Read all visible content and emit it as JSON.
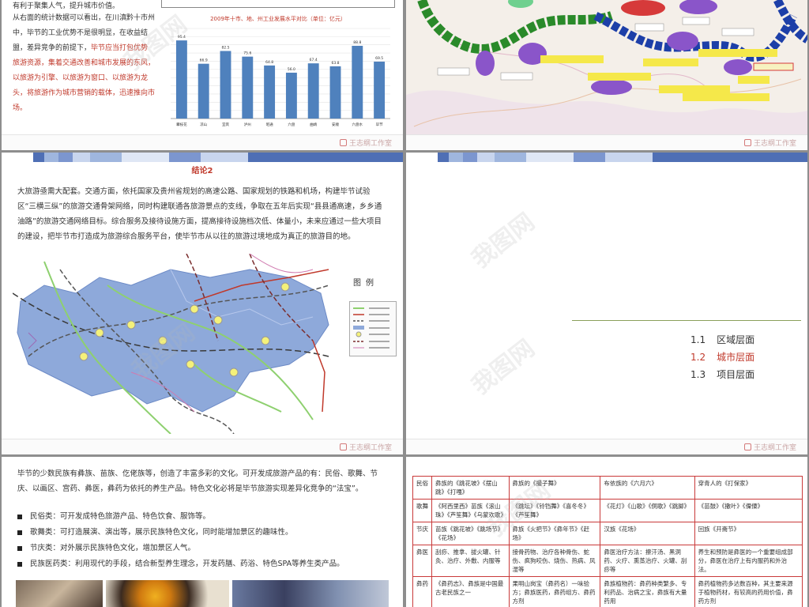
{
  "brand": "王志纲工作室",
  "watermark": "我图网",
  "slide1": {
    "top_fragment": "有利于聚集人气，提升城市价值。",
    "para_normal": "从右面的统计数据可以看出，在川滇黔十市州中，毕节的工业优势不是很明显，在收益结盟，差异竞争的前提下，",
    "para_red": "毕节应当打包优势旅游资源，集着交通改善和城市发展的东风，以旅游为引擎、以旅游为窗口、以旅游为龙头，将旅游作为城市营销的载体，迅速推向市场。"
  },
  "chart_data": {
    "type": "bar",
    "title": "2009年十市、地、州工业发展水平对比（单位：亿元）",
    "categories": [
      "攀枝花",
      "凉山",
      "宜宾",
      "泸州",
      "昭通",
      "六盘",
      "曲靖",
      "安顺",
      "六盘水",
      "毕节"
    ],
    "values": [
      95.4,
      66.9,
      82.5,
      75.6,
      64.8,
      56.0,
      67.4,
      63.8,
      88.8,
      69.5
    ],
    "data_labels": [
      "95.4",
      "66.9",
      "82.5",
      "75.6",
      "64.8",
      "56.0",
      "67.4",
      "63.8",
      "88.8",
      "69.5"
    ],
    "ylim": [
      0,
      110
    ],
    "grid": true,
    "bar_color": "#4f81bd"
  },
  "slide3": {
    "title": "结论2",
    "body": "大旅游亟需大配套。交通方面，依托国家及贵州省规划的高速公路、国家规划的铁路和机场，构建毕节试验区“三横三纵”的旅游交通骨架网络，同时构建联通各旅游景点的支线，争取在五年后实现“县县通高速，乡乡通油路”的旅游交通网络目标。综合服务及接待设施方面，提高接待设施档次低、体量小，未来应通过一些大项目的建设，把毕节市打造成为旅游综合服务平台，使毕节市从以往的旅游过境地成为真正的旅游目的地。",
    "legend_title": "图例"
  },
  "slide4": {
    "toc": [
      {
        "num": "1.1",
        "label": "区域层面",
        "active": false
      },
      {
        "num": "1.2",
        "label": "城市层面",
        "active": true
      },
      {
        "num": "1.3",
        "label": "项目层面",
        "active": false
      }
    ]
  },
  "slide5": {
    "intro": "毕节的少数民族有彝族、苗族、仡佬族等，创造了丰富多彩的文化。可开发成旅游产品的有：民俗、歌舞、节庆、以画区、宫药、彝医，彝药为依托的养生产品。特色文化必将是毕节旅游实现差异化竞争的“法宝”。",
    "bullets": [
      "民俗类：可开发成特色旅游产品、特色饮食、服饰等。",
      "歌舞类：可打造展演、演出等，展示民族特色文化，同时能增加景区的趣味性。",
      "节庆类：对外展示民族特色文化，增加景区人气。",
      "民族医药类：利用现代的手段，结合新型养生理念，开发药膳、药浴、特色SPA等养生类产品。"
    ]
  },
  "slide6": {
    "rows": [
      {
        "head": "民俗",
        "cells": [
          "彝族的《跳花坡》《摆山跳》《打嘎》",
          "彝族的《撮子舞》",
          "布依族的《六月六》",
          "穿青人的《打保家》"
        ]
      },
      {
        "head": "歌舞",
        "cells": [
          "《阿西里西》苗族《滚山珠》《芦笙舞》《乌蒙欢歌》",
          "《跳坛》《铃铛舞》《喜冬冬》《芦笙舞》",
          "《花灯》《山歌》《侗歌》《跳脚》",
          "《苗鼓》《撒叶》《傈僳》"
        ]
      },
      {
        "head": "节庆",
        "cells": [
          "苗族《跳花坡》《跳场节》《花场》",
          "彝族《火把节》《彝年节》《赶场》",
          "汉族《花场》",
          "回族《开斋节》"
        ]
      },
      {
        "head": "彝医",
        "cells": [
          "刮痧、推拿、拔火罐、针灸、治疗、外敷、内服等",
          "接骨药物、治疗各种骨伤、蛇伤、疯狗咬伤、烧伤、热病、风湿等",
          "彝医治疗方法：擦汗汤、黑洞药、火疗、熏蒸治疗、火罐、刮痧等",
          "养生和预防是彝医的一个重要组成部分，彝医在治疗上有内服药和外治法。"
        ]
      },
      {
        "head": "彝药",
        "cells": [
          "《彝药志》、彝族是中国最古老民族之一",
          "果明山岗宝（彝药名）一味验方；彝族医药，彝药组方、彝药方剂",
          "彝族植物药：彝药种类繁多、专利药品、治病之宝，彝族有大量药用",
          "彝药植物药多达数百种，其主要来源于植物药材，有较高的药用价值，彝药方剂"
        ]
      }
    ]
  }
}
